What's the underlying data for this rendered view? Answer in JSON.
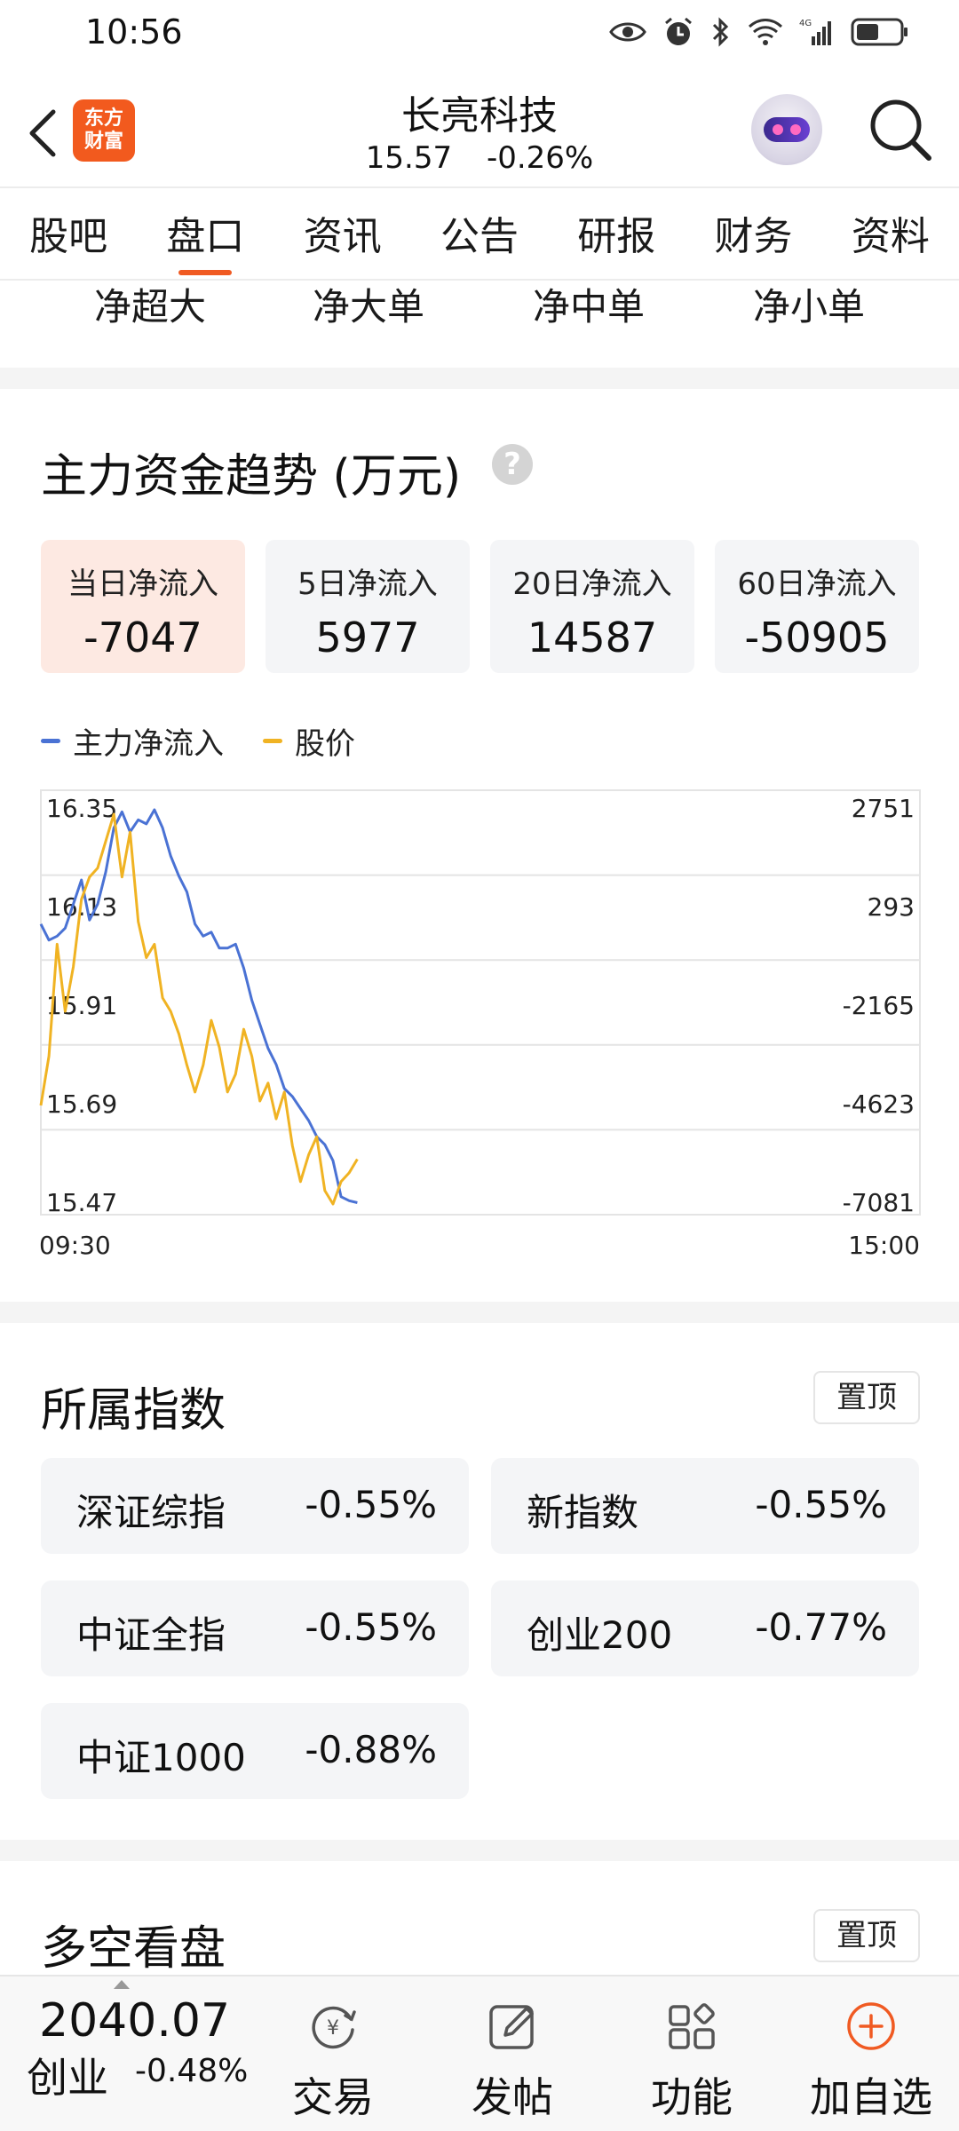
{
  "status_bar": {
    "time": "10:56",
    "network": "4G"
  },
  "header": {
    "logo_text": "东方财富",
    "stock_name": "长亮科技",
    "price": "15.57",
    "change_pct": "-0.26%"
  },
  "tabs": [
    {
      "label": "股吧"
    },
    {
      "label": "盘口"
    },
    {
      "label": "资讯"
    },
    {
      "label": "公告"
    },
    {
      "label": "研报"
    },
    {
      "label": "财务"
    },
    {
      "label": "资料"
    }
  ],
  "active_tab": "盘口",
  "flow_labels": [
    "净超大",
    "净大单",
    "净中单",
    "净小单"
  ],
  "trend": {
    "title": "主力资金趋势 (万元)",
    "help": "?",
    "cards": [
      {
        "label": "当日净流入",
        "value": "-7047"
      },
      {
        "label": "5日净流入",
        "value": "5977"
      },
      {
        "label": "20日净流入",
        "value": "14587"
      },
      {
        "label": "60日净流入",
        "value": "-50905"
      }
    ],
    "legend": [
      {
        "name": "主力净流入",
        "color": "#4a72d4"
      },
      {
        "name": "股价",
        "color": "#f0b323"
      }
    ]
  },
  "chart_data": {
    "type": "line",
    "x_start": "09:30",
    "x_end": "15:00",
    "left_axis_ticks": [
      "16.35",
      "16.13",
      "15.91",
      "15.69",
      "15.47"
    ],
    "right_axis_ticks": [
      "2751",
      "293",
      "-2165",
      "-4623",
      "-7081"
    ],
    "ylim_price": [
      15.47,
      16.35
    ],
    "ylim_flow": [
      -7081,
      2751
    ],
    "grid": true,
    "series": [
      {
        "name": "主力净流入",
        "color": "#4a72d4",
        "axis": "right",
        "values": [
          -100,
          -500,
          -400,
          -200,
          400,
          1000,
          0,
          400,
          1200,
          2300,
          2700,
          2200,
          2500,
          2400,
          2750,
          2300,
          1600,
          1100,
          700,
          -100,
          -400,
          -300,
          -700,
          -700,
          -600,
          -1200,
          -2000,
          -2600,
          -3200,
          -3600,
          -4200,
          -4400,
          -4700,
          -5000,
          -5400,
          -5600,
          -6000,
          -6900,
          -7000,
          -7047
        ]
      },
      {
        "name": "股价",
        "color": "#f0b323",
        "axis": "left",
        "values": [
          15.69,
          15.8,
          16.05,
          15.9,
          16.0,
          16.15,
          16.2,
          16.22,
          16.28,
          16.34,
          16.2,
          16.3,
          16.1,
          16.02,
          16.05,
          15.93,
          15.9,
          15.85,
          15.78,
          15.72,
          15.78,
          15.88,
          15.82,
          15.72,
          15.76,
          15.86,
          15.8,
          15.7,
          15.74,
          15.66,
          15.72,
          15.6,
          15.52,
          15.58,
          15.62,
          15.5,
          15.47,
          15.52,
          15.54,
          15.57
        ]
      }
    ]
  },
  "index_section": {
    "title": "所属指数",
    "pin_label": "置顶",
    "items": [
      {
        "name": "深证综指",
        "pct": "-0.55%"
      },
      {
        "name": "新指数",
        "pct": "-0.55%"
      },
      {
        "name": "中证全指",
        "pct": "-0.55%"
      },
      {
        "name": "创业200",
        "pct": "-0.77%"
      },
      {
        "name": "中证1000",
        "pct": "-0.88%"
      }
    ]
  },
  "outlook_section": {
    "title": "多空看盘",
    "pin_label": "置顶"
  },
  "bottom_bar": {
    "index_value": "2040.07",
    "index_name": "创业",
    "index_change": "-0.48%",
    "items": [
      {
        "label": "交易",
        "icon": "trade-icon"
      },
      {
        "label": "发帖",
        "icon": "post-icon"
      },
      {
        "label": "功能",
        "icon": "function-icon"
      },
      {
        "label": "加自选",
        "icon": "add-watchlist-icon",
        "color": "#f05a22"
      }
    ]
  }
}
